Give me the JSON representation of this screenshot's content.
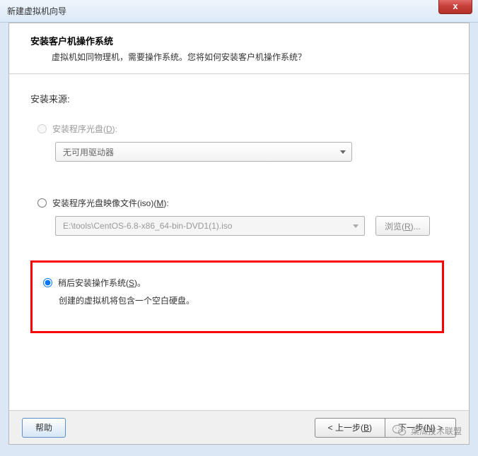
{
  "window": {
    "title": "新建虚拟机向导",
    "close_label": "x"
  },
  "header": {
    "title": "安装客户机操作系统",
    "subtitle": "虚拟机如同物理机，需要操作系统。您将如何安装客户机操作系统？"
  },
  "source": {
    "label": "安装来源:",
    "option_disc": {
      "label_prefix": "安装程序光盘(",
      "label_key": "D",
      "label_suffix": "):",
      "dropdown_value": "无可用驱动器"
    },
    "option_iso": {
      "label_prefix": "安装程序光盘映像文件(iso)(",
      "label_key": "M",
      "label_suffix": "):",
      "path": "E:\\tools\\CentOS-6.8-x86_64-bin-DVD1(1).iso",
      "browse_prefix": "浏览(",
      "browse_key": "R",
      "browse_suffix": ")..."
    },
    "option_later": {
      "label_prefix": "稍后安装操作系统(",
      "label_key": "S",
      "label_suffix": ")。",
      "description": "创建的虚拟机将包含一个空白硬盘。"
    }
  },
  "buttons": {
    "help": "帮助",
    "back_prefix": "< 上一步(",
    "back_key": "B",
    "back_suffix": ")",
    "next_prefix": "下一步(",
    "next_key": "N",
    "next_suffix": ") >"
  },
  "watermark": {
    "text": "菜瓜技术联盟"
  }
}
